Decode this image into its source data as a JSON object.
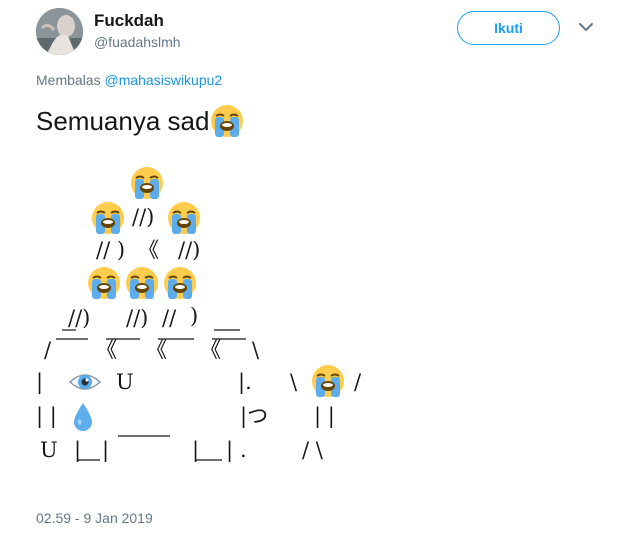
{
  "author": {
    "display_name": "Fuckdah",
    "handle": "@fuadahslmh"
  },
  "follow_button": {
    "label": "Ikuti"
  },
  "reply": {
    "prefix": "Membalas",
    "mention": "@mahasiswikupu2"
  },
  "tweet": {
    "text": "Semuanya sad",
    "text_emoji": "loudly-crying-face-icon",
    "art_lines": [
      "//)",
      "// )",
      "《",
      "//)",
      "//)",
      "//)",
      "//",
      ")",
      "/",
      "《",
      "《",
      "《",
      "\\",
      "|",
      "U",
      "|.",
      "\\",
      "/",
      "| |",
      "|つ",
      "| |",
      "U",
      "|",
      "|",
      "|",
      "|",
      ".",
      "/ \\"
    ]
  },
  "timestamp": "02.59 - 9 Jan 2019",
  "colors": {
    "accent": "#1da1f2",
    "mention": "#1b95e0",
    "secondary_text": "#657786",
    "primary_text": "#14171a",
    "emoji_face": "#ffcc4d",
    "emoji_tear": "#5dadec"
  }
}
